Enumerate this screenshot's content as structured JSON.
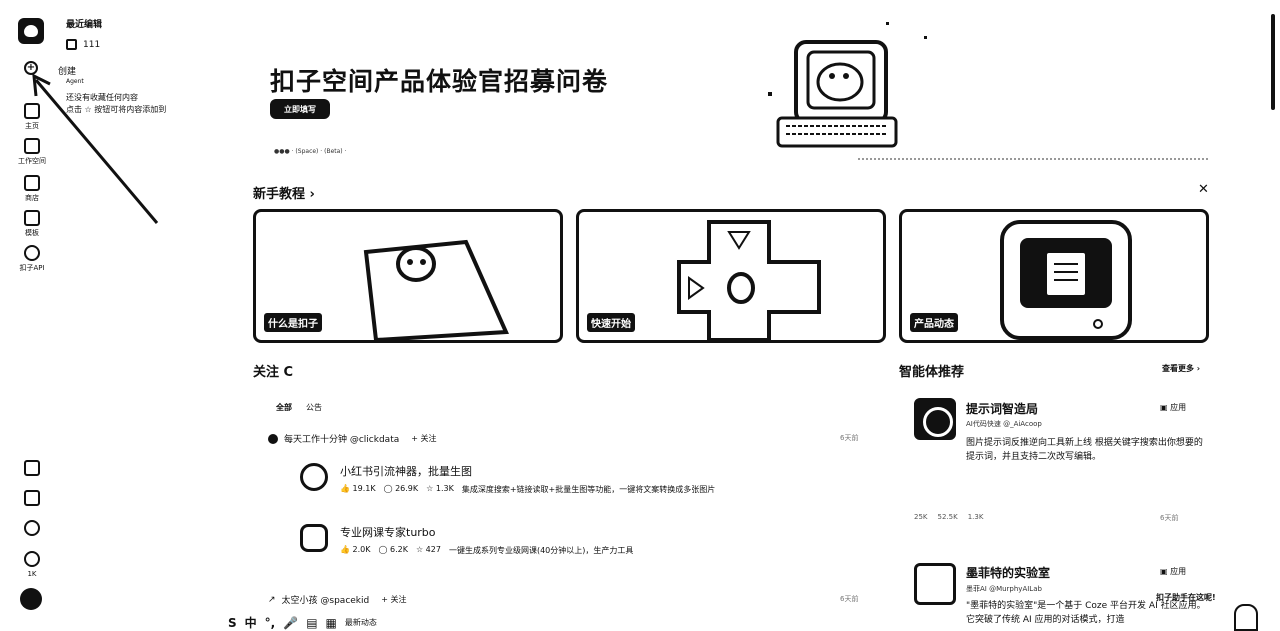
{
  "rail": {
    "items": [
      {
        "label": "主页",
        "icon": "home-icon"
      },
      {
        "label": "工作空间",
        "icon": "folder-icon"
      },
      {
        "label": "商店",
        "icon": "store-icon"
      },
      {
        "label": "模板",
        "icon": "template-icon"
      },
      {
        "label": "扣子API",
        "icon": "api-icon"
      }
    ],
    "bottom": {
      "star_count": "1K"
    }
  },
  "recent": {
    "title": "最近编辑",
    "item": "111",
    "create": "创建",
    "create_sub": "Agent",
    "hint": "还没有收藏任何内容\n点击 ☆ 按钮可将内容添加到"
  },
  "banner": {
    "title": "扣子空间产品体验官招募问卷",
    "button": "立即填写",
    "sub": "●●● · (Space) · (Beta) ·"
  },
  "tutorials": {
    "title": "新手教程 ›",
    "cards": [
      {
        "tag": "什么是扣子"
      },
      {
        "tag": "快速开始"
      },
      {
        "tag": "产品动态"
      }
    ]
  },
  "follow": {
    "title": "关注 C",
    "tabs": [
      "全部",
      "公告"
    ],
    "feeds": [
      {
        "author": "每天工作十分钟 @clickdata",
        "follow": "+ 关注",
        "time": "6天前",
        "bots": [
          {
            "name": "小红书引流神器，批量生图",
            "likes": "19.1K",
            "comments": "26.9K",
            "stars": "1.3K",
            "desc": "集成深度搜索+链接读取+批量生图等功能，一键将文案转换成多张图片"
          },
          {
            "name": "专业网课专家turbo",
            "likes": "2.0K",
            "comments": "6.2K",
            "stars": "427",
            "desc": "一键生成系列专业级网课(40分钟以上)，生产力工具"
          }
        ]
      },
      {
        "author": "太空小孩 @spacekid",
        "follow": "+ 关注",
        "time": "6天前"
      }
    ]
  },
  "recommend": {
    "title": "智能体推荐",
    "see_more": "查看更多 ›",
    "items": [
      {
        "name": "提示词智造局",
        "type": "应用",
        "author": "AI代码快速 @_AiAcoop",
        "desc": "图片提示词反推逆向工具新上线 根据关键字搜索出你想要的提示词，并且支持二次改写编辑。",
        "stats": [
          "25K",
          "52.5K",
          "1.3K"
        ],
        "time": "6天前"
      },
      {
        "name": "墨菲特的实验室",
        "type": "应用",
        "author": "墨菲AI @MurphyAILab",
        "desc": "\"墨菲特的实验室\"是一个基于 Coze 平台开发 AI 社区应用。它突破了传统 AI 应用的对话模式，打造"
      }
    ]
  },
  "bottom_tray": [
    "S",
    "中",
    "°,",
    "🎤",
    "▤",
    "▦"
  ],
  "bottom_tray_text": "最新动态",
  "assistant": "扣子助手在这呢!"
}
